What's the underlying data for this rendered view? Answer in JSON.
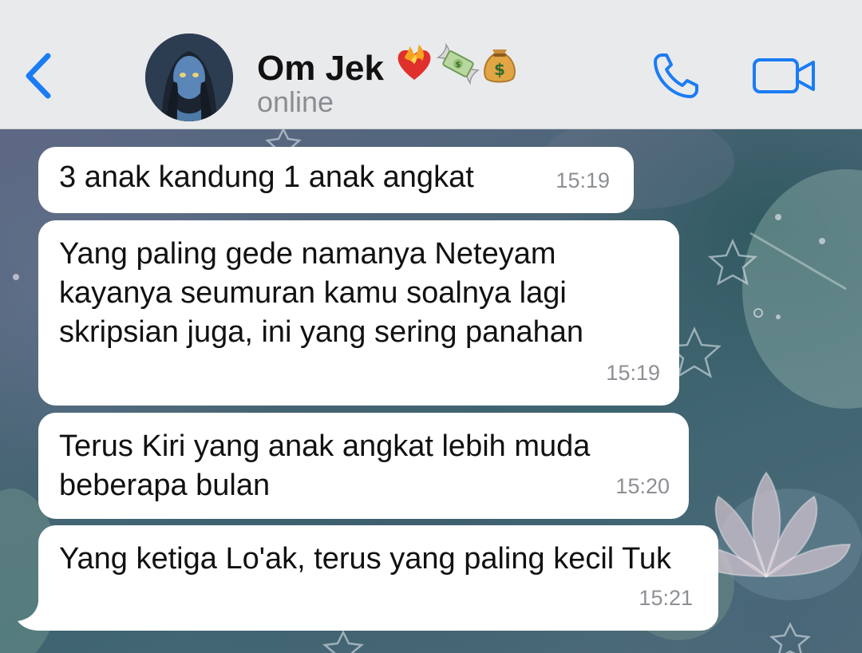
{
  "header": {
    "back_icon": "chevron-left-icon",
    "contact_name": "Om Jek",
    "name_emojis": [
      "heart-on-fire-emoji",
      "money-with-wings-emoji",
      "money-bag-emoji"
    ],
    "status": "online",
    "call_icon": "phone-icon",
    "video_icon": "video-camera-icon",
    "accent_color": "#1a7cf5"
  },
  "messages": [
    {
      "text": "3 anak kandung 1 anak angkat",
      "time": "15:19",
      "direction": "incoming"
    },
    {
      "text": "Yang paling gede namanya Neteyam kayanya seumuran kamu soalnya lagi skripsian juga, ini yang sering panahan",
      "time": "15:19",
      "direction": "incoming"
    },
    {
      "text": "Terus Kiri yang anak angkat lebih muda beberapa bulan",
      "time": "15:20",
      "direction": "incoming"
    },
    {
      "text": "Yang ketiga Lo'ak, terus yang paling kecil Tuk",
      "time": "15:21",
      "direction": "incoming"
    }
  ]
}
